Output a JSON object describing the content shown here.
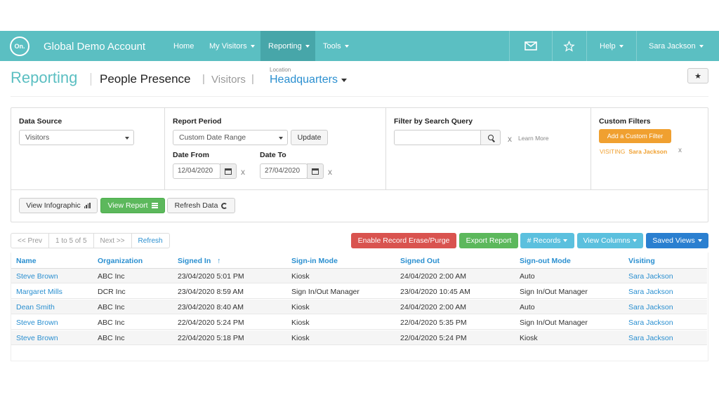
{
  "nav": {
    "logo_text": "On.",
    "brand": "Global Demo Account",
    "items": [
      {
        "label": "Home",
        "caret": false
      },
      {
        "label": "My Visitors",
        "caret": true
      },
      {
        "label": "Reporting",
        "caret": true,
        "active": true
      },
      {
        "label": "Tools",
        "caret": true
      }
    ],
    "right_items": [
      {
        "label": "Help",
        "caret": true
      },
      {
        "label": "Sara Jackson",
        "caret": true
      }
    ],
    "mail_icon": "envelope-icon",
    "star_icon": "star-icon"
  },
  "header": {
    "title": "Reporting",
    "subtitle": "People Presence",
    "sep1": "|",
    "crumb": "Visitors",
    "sep2": "|",
    "location_label": "Location",
    "location_value": "Headquarters",
    "star_button": "★"
  },
  "filters": {
    "data_source": {
      "label": "Data Source",
      "value": "Visitors"
    },
    "report_period": {
      "label": "Report Period",
      "value": "Custom Date Range",
      "update_label": "Update",
      "date_from_label": "Date From",
      "date_from": "12/04/2020",
      "date_to_label": "Date To",
      "date_to": "27/04/2020",
      "clear": "x"
    },
    "search": {
      "label": "Filter by Search Query",
      "value": "",
      "clear": "x",
      "learn_more": "Learn More"
    },
    "custom": {
      "label": "Custom Filters",
      "add_label": "Add a Custom Filter",
      "tag_key": "VISITING",
      "tag_value": "Sara Jackson",
      "tag_remove": "x"
    },
    "buttons": {
      "infographic": "View Infographic",
      "view_report": "View Report",
      "refresh": "Refresh Data"
    }
  },
  "pager": {
    "prev": "<< Prev",
    "range": "1 to 5 of 5",
    "next": "Next >>",
    "refresh": "Refresh"
  },
  "actions": {
    "erase": "Enable Record Erase/Purge",
    "export": "Export Report",
    "records": "# Records",
    "columns": "View Columns",
    "saved": "Saved Views",
    "colors": {
      "erase": "#d9534f",
      "export": "#5cb85c",
      "info": "#5bc0de",
      "primary": "#2a7fd0"
    }
  },
  "table": {
    "headers": [
      "Name",
      "Organization",
      "Signed In",
      "Sign-in Mode",
      "Signed Out",
      "Sign-out Mode",
      "Visiting"
    ],
    "sort_indicator": "↑",
    "rows": [
      [
        "Steve Brown",
        "ABC Inc",
        "23/04/2020 5:01 PM",
        "Kiosk",
        "24/04/2020 2:00 AM",
        "Auto",
        "Sara Jackson"
      ],
      [
        "Margaret Mills",
        "DCR Inc",
        "23/04/2020 8:59 AM",
        "Sign In/Out Manager",
        "23/04/2020 10:45 AM",
        "Sign In/Out Manager",
        "Sara Jackson"
      ],
      [
        "Dean Smith",
        "ABC Inc",
        "23/04/2020 8:40 AM",
        "Kiosk",
        "24/04/2020 2:00 AM",
        "Auto",
        "Sara Jackson"
      ],
      [
        "Steve Brown",
        "ABC Inc",
        "22/04/2020 5:24 PM",
        "Kiosk",
        "22/04/2020 5:35 PM",
        "Sign In/Out Manager",
        "Sara Jackson"
      ],
      [
        "Steve Brown",
        "ABC Inc",
        "22/04/2020 5:18 PM",
        "Kiosk",
        "22/04/2020 5:24 PM",
        "Kiosk",
        "Sara Jackson"
      ]
    ]
  }
}
